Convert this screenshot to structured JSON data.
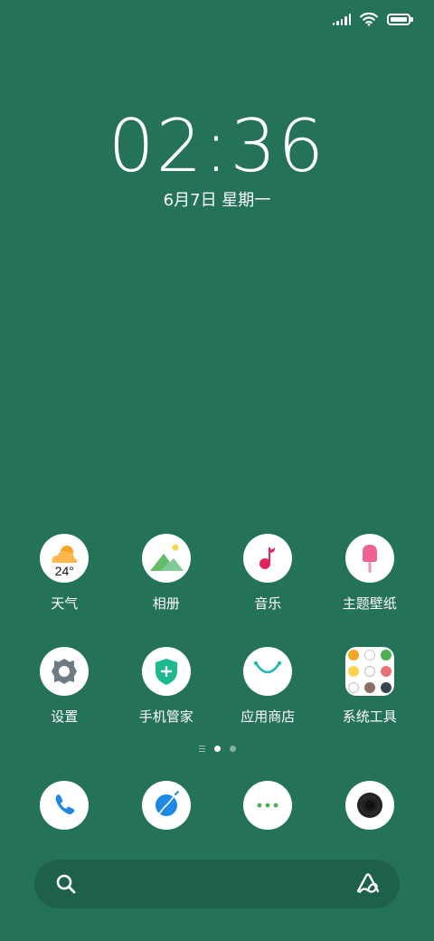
{
  "status_bar": {
    "signal_icon": "cellular-signal-icon",
    "wifi_icon": "wifi-icon",
    "battery_icon": "battery-icon",
    "battery_level": 1.0
  },
  "lock": {
    "time": "02:36",
    "date": "6月7日 星期一"
  },
  "apps": [
    {
      "label": "天气",
      "icon": "weather-icon",
      "temp": "24°"
    },
    {
      "label": "相册",
      "icon": "gallery-icon"
    },
    {
      "label": "音乐",
      "icon": "music-icon"
    },
    {
      "label": "主题壁纸",
      "icon": "themes-icon"
    },
    {
      "label": "设置",
      "icon": "settings-icon"
    },
    {
      "label": "手机管家",
      "icon": "security-icon"
    },
    {
      "label": "应用商店",
      "icon": "app-store-icon"
    },
    {
      "label": "系统工具",
      "icon": "folder-icon"
    }
  ],
  "pager": {
    "pages": 2,
    "active_page": 1
  },
  "dock": [
    {
      "icon": "phone-icon"
    },
    {
      "icon": "browser-icon"
    },
    {
      "icon": "messages-icon"
    },
    {
      "icon": "camera-icon"
    }
  ],
  "search": {
    "search_icon": "search-icon",
    "assistant_icon": "assistant-icon"
  },
  "colors": {
    "background": "#247257",
    "weather_sun": "#F5A623",
    "gallery": "#6CBF84",
    "music": "#E0245E",
    "themes": "#F06292",
    "settings": "#6E7B83",
    "security": "#1DB98F",
    "app_store": "#26B6B0",
    "phone": "#1E88E5",
    "browser": "#1E88E5",
    "messages": "#4CAF50",
    "camera": "#222222"
  }
}
